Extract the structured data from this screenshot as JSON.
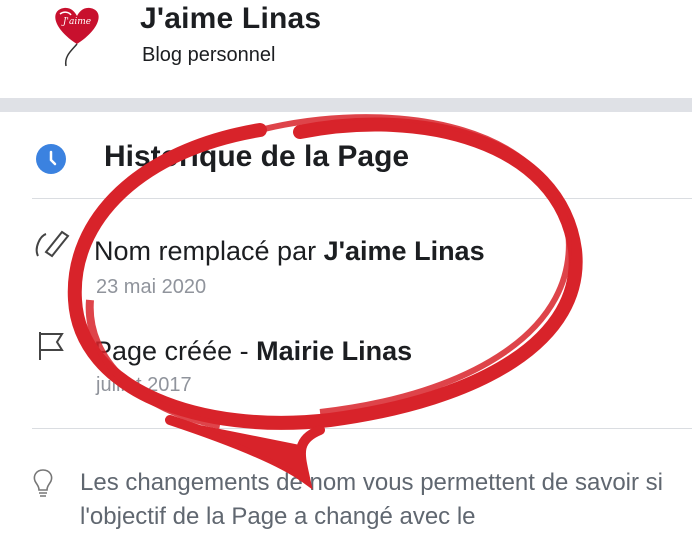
{
  "header": {
    "title": "J'aime Linas",
    "subtitle": "Blog personnel",
    "avatar_text": "J'aime"
  },
  "section": {
    "title": "Historique de la Page",
    "icon": "clock-icon",
    "icon_color": "#3b82e0"
  },
  "history": [
    {
      "icon": "pencil-icon",
      "text_prefix": "Nom remplacé par ",
      "text_bold": "J'aime Linas",
      "date": "23 mai 2020"
    },
    {
      "icon": "flag-icon",
      "text_prefix": "Page créée - ",
      "text_bold": "Mairie Linas",
      "date": "juillet 2017"
    }
  ],
  "info": {
    "icon": "lightbulb-icon",
    "text": "Les changements de nom vous permettent de savoir si l'objectif de la Page a changé avec le"
  },
  "colors": {
    "annotation_red": "#d8232a",
    "band": "#dfe1e6",
    "muted_text": "#90949c"
  }
}
